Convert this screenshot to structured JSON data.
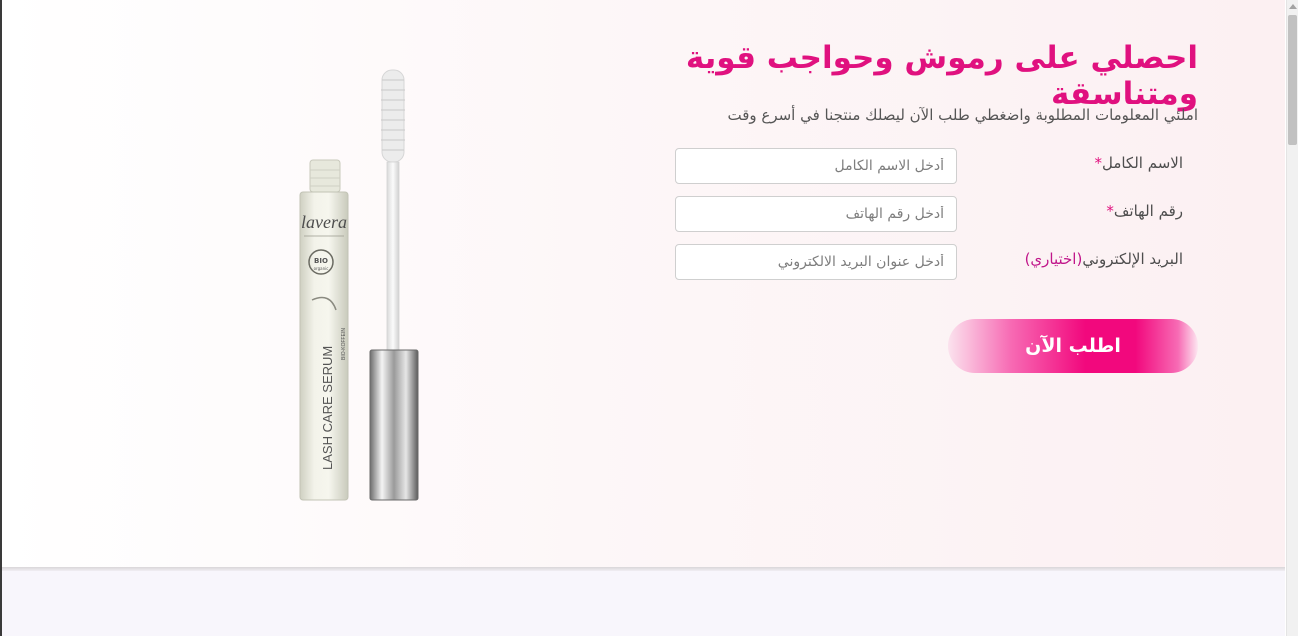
{
  "form": {
    "title": "احصلي على رموش وحواجب قوية ومتناسقة",
    "subtitle": "املئي المعلومات المطلوبة واضغطي طلب الآن ليصلك منتجنا في أسرع وقت",
    "fields": [
      {
        "label": "الاسم الكامل",
        "required_mark": "*",
        "optional_note": "",
        "placeholder": "أدخل الاسم الكامل"
      },
      {
        "label": "رقم الهاتف",
        "required_mark": "*",
        "optional_note": "",
        "placeholder": "أدخل رقم الهاتف"
      },
      {
        "label": "البريد الإلكتروني",
        "required_mark": "",
        "optional_note": "(اختياري)",
        "placeholder": "أدخل عنوان البريد الالكتروني"
      }
    ],
    "submit_label": "اطلب الآن"
  },
  "product": {
    "brand": "lavera",
    "seal": "BIO",
    "seal_sub": "organic",
    "name": "LASH CARE SERUM",
    "subname": "BIO-KOFFEIN"
  },
  "colors": {
    "accent": "#e0117f",
    "button": "#f2087d",
    "text": "#555555"
  }
}
